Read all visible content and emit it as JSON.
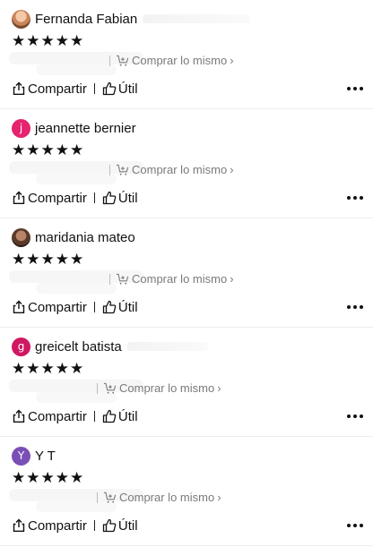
{
  "reviews": [
    {
      "username": "Fernanda Fabian",
      "avatar": {
        "type": "photo",
        "letter": "",
        "color": ""
      },
      "stars": 5
    },
    {
      "username": "jeannette bernier",
      "avatar": {
        "type": "letter",
        "letter": "j",
        "color": "#e5236f"
      },
      "stars": 5
    },
    {
      "username": "maridania mateo",
      "avatar": {
        "type": "photo",
        "letter": "",
        "color": ""
      },
      "stars": 5
    },
    {
      "username": "greicelt batista",
      "avatar": {
        "type": "letter",
        "letter": "g",
        "color": "#d01762"
      },
      "stars": 5
    },
    {
      "username": "Y T",
      "avatar": {
        "type": "letter",
        "letter": "Y",
        "color": "#7a4fb5"
      },
      "stars": 5
    }
  ],
  "labels": {
    "buy_same": "Comprar lo mismo",
    "share": "Compartir",
    "helpful": "Útil",
    "star_glyph": "★"
  }
}
